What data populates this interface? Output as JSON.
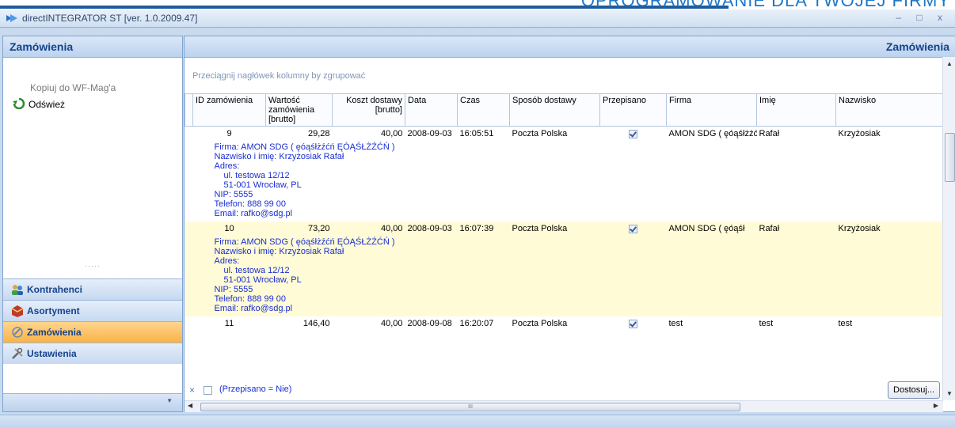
{
  "banner": {
    "text": "OPROGRAMOWANIE DLA TWOJEJ FIRMY"
  },
  "window": {
    "title": "directINTEGRATOR ST [ver. 1.0.2009.47]",
    "controls": "– □ x"
  },
  "nav": {
    "header": "Zamówienia",
    "actions": [
      {
        "label": "Kopiuj do WF-Mag'a",
        "enabled": false
      },
      {
        "label": "Odśwież",
        "enabled": true,
        "icon": "refresh-icon"
      }
    ],
    "groups": [
      {
        "label": "Kontrahenci",
        "icon": "contacts-icon",
        "active": false
      },
      {
        "label": "Asortyment",
        "icon": "box-icon",
        "active": false
      },
      {
        "label": "Zamówienia",
        "icon": "orders-icon",
        "active": true
      },
      {
        "label": "Ustawienia",
        "icon": "settings-icon",
        "active": false
      }
    ]
  },
  "main": {
    "header": "Zamówienia",
    "group_hint": "Przeciągnij nagłówek kolumny by zgrupować",
    "columns": [
      "ID zamówienia",
      "Wartość zamówienia [brutto]",
      "Koszt dostawy [brutto]",
      "Data",
      "Czas",
      "Sposób dostawy",
      "Przepisano",
      "Firma",
      "Imię",
      "Nazwisko"
    ],
    "rows": [
      {
        "id": "9",
        "value": "29,28",
        "shipping": "40,00",
        "date": "2008-09-03",
        "time": "16:05:51",
        "method": "Poczta Polska",
        "copied": true,
        "company": "AMON SDG ( ęóąśłżźćń",
        "first": "Rafał",
        "last": "Krzyżosiak",
        "detail": {
          "firma": "Firma: AMON SDG ( ęóąśłżźćń ĘÓĄŚŁŻŹĆŃ )",
          "name": "Nazwisko i imię: Krzyżosiak Rafał",
          "addr_label": "Adres:",
          "street": "ul. testowa 12/12",
          "city": "51-001 Wrocław, PL",
          "nip": "NIP: 5555",
          "phone": "Telefon: 888 99 00",
          "email": "Email: rafko@sdg.pl"
        }
      },
      {
        "id": "10",
        "value": "73,20",
        "shipping": "40,00",
        "date": "2008-09-03",
        "time": "16:07:39",
        "method": "Poczta Polska",
        "copied": true,
        "company": "AMON SDG ( ęóąśł",
        "first": "Rafał",
        "last": "Krzyżosiak",
        "detail": {
          "firma": "Firma: AMON SDG ( ęóąśłżźćń ĘÓĄŚŁŻŹĆŃ )",
          "name": "Nazwisko i imię: Krzyżosiak Rafał",
          "addr_label": "Adres:",
          "street": "ul. testowa 12/12",
          "city": "51-001 Wrocław, PL",
          "nip": "NIP: 5555",
          "phone": "Telefon: 888 99 00",
          "email": "Email: rafko@sdg.pl"
        }
      },
      {
        "id": "11",
        "value": "146,40",
        "shipping": "40,00",
        "date": "2008-09-08",
        "time": "16:20:07",
        "method": "Poczta Polska",
        "copied": true,
        "company": "test",
        "first": "test",
        "last": "test"
      }
    ],
    "filter": {
      "text": "(Przepisano = Nie)",
      "clear": "×"
    },
    "customize_button": "Dostosuj...",
    "scroll_grip": "III"
  }
}
